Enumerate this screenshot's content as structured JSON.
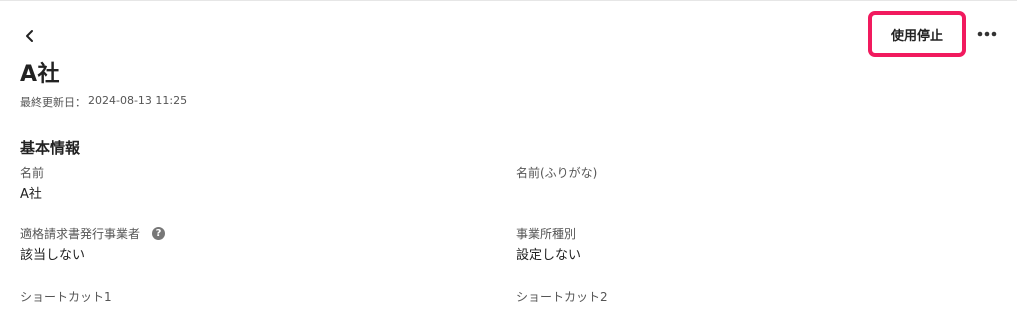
{
  "header": {
    "title": "A社",
    "updated_label": "最終更新日：",
    "updated_value": "2024-08-13 11:25",
    "stop_button": "使用停止",
    "accent_color": "#f11a5e"
  },
  "section": {
    "title": "基本情報"
  },
  "fields": {
    "name": {
      "label": "名前",
      "value": "A社"
    },
    "name_kana": {
      "label": "名前(ふりがな)",
      "value": ""
    },
    "invoice_issuer": {
      "label": "適格請求書発行事業者",
      "value": "該当しない",
      "help_icon": "?"
    },
    "office_type": {
      "label": "事業所種別",
      "value": "設定しない"
    },
    "shortcut1": {
      "label": "ショートカット1"
    },
    "shortcut2": {
      "label": "ショートカット2"
    }
  }
}
